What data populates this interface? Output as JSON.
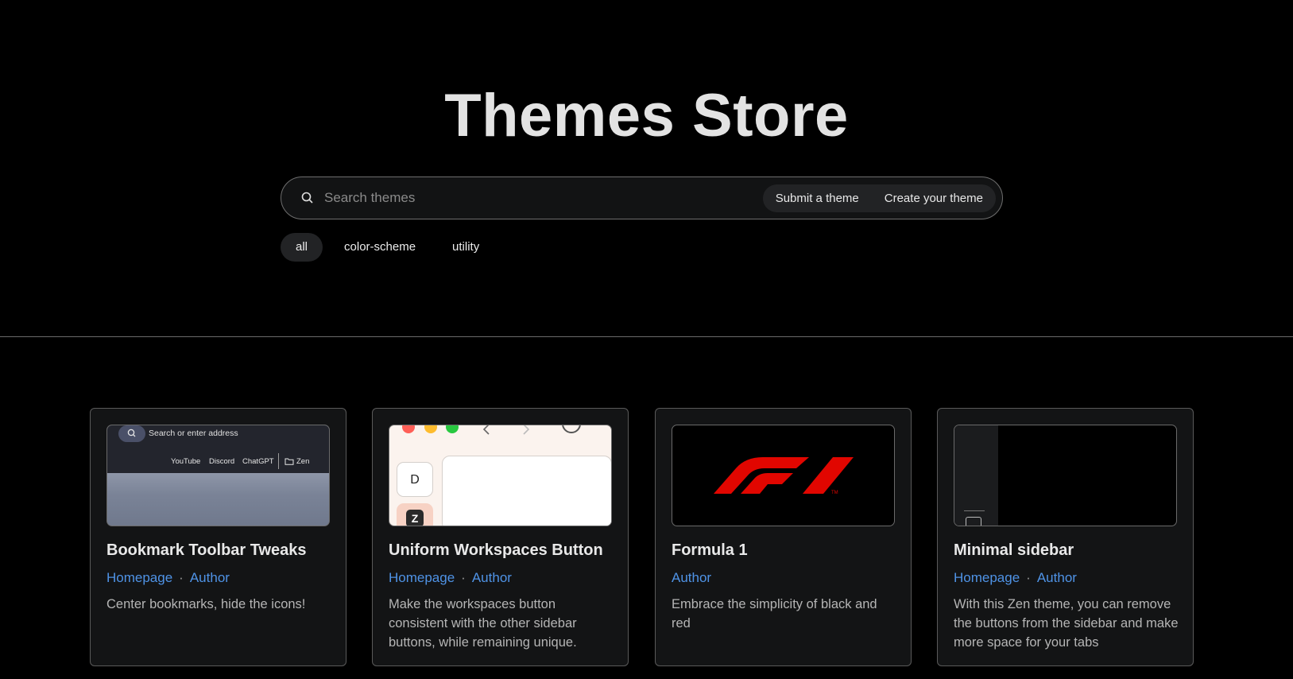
{
  "page": {
    "title": "Themes Store"
  },
  "search": {
    "placeholder": "Search themes"
  },
  "actions": {
    "submit_label": "Submit a theme",
    "create_label": "Create your theme"
  },
  "filters": [
    {
      "label": "all",
      "active": true
    },
    {
      "label": "color-scheme",
      "active": false
    },
    {
      "label": "utility",
      "active": false
    }
  ],
  "themes": [
    {
      "name": "Bookmark Toolbar Tweaks",
      "homepage_label": "Homepage",
      "author_label": "Author",
      "description": "Center bookmarks, hide the icons!",
      "preview": {
        "url_placeholder": "Search or enter address",
        "bookmarks": [
          "YouTube",
          "Discord",
          "ChatGPT",
          "Zen"
        ]
      }
    },
    {
      "name": "Uniform Workspaces Button",
      "homepage_label": "Homepage",
      "author_label": "Author",
      "description": "Make the workspaces button consistent with the other sidebar buttons, while remaining unique.",
      "preview": {
        "workspace_letter": "D",
        "zen_glyph": "Z"
      }
    },
    {
      "name": "Formula 1",
      "author_label": "Author",
      "description": "Embrace the simplicity of black and red",
      "preview": {
        "tm": "TM"
      }
    },
    {
      "name": "Minimal sidebar",
      "homepage_label": "Homepage",
      "author_label": "Author",
      "description": "With this Zen theme, you can remove the buttons from the sidebar and make more space for your tabs"
    }
  ],
  "colors": {
    "background": "#000000",
    "link": "#4f93e6",
    "f1_red": "#e10600"
  }
}
